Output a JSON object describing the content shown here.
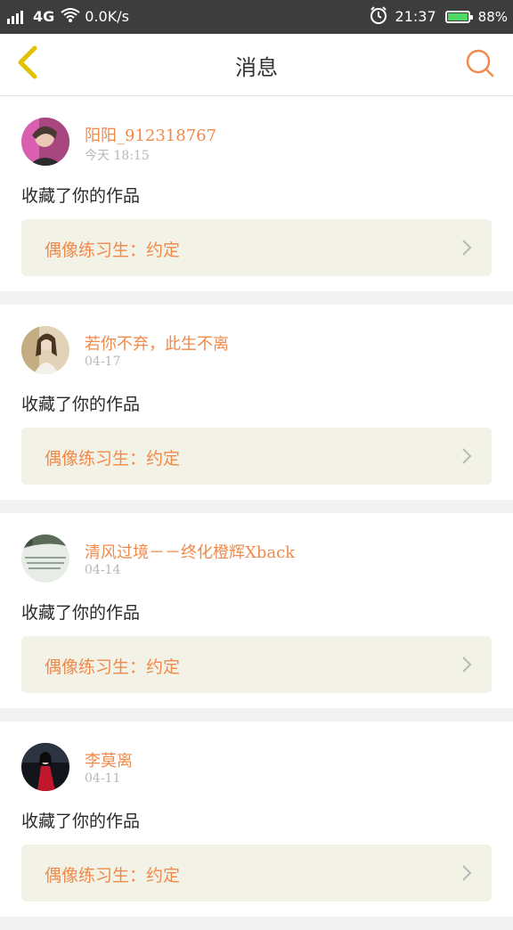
{
  "status_bar": {
    "network": "4G",
    "speed": "0.0K/s",
    "time": "21:37",
    "battery": "88%",
    "battery_level": 0.88
  },
  "nav": {
    "title": "消息",
    "back_icon": "chevron-left-icon",
    "search_icon": "search-icon"
  },
  "colors": {
    "accent": "#f08a4b",
    "back_icon": "#e0c200",
    "card_bg": "#f3f2e6"
  },
  "messages": [
    {
      "username": "阳阳_912318767",
      "time": "今天 18:15",
      "action": "收藏了你的作品",
      "work_title": "偶像练习生：约定"
    },
    {
      "username": "若你不弃，此生不离",
      "time": "04-17",
      "action": "收藏了你的作品",
      "work_title": "偶像练习生：约定"
    },
    {
      "username": "清风过境－－终化橙辉Xback",
      "time": "04-14",
      "action": "收藏了你的作品",
      "work_title": "偶像练习生：约定"
    },
    {
      "username": "李莫离",
      "time": "04-11",
      "action": "收藏了你的作品",
      "work_title": "偶像练习生：约定"
    }
  ]
}
